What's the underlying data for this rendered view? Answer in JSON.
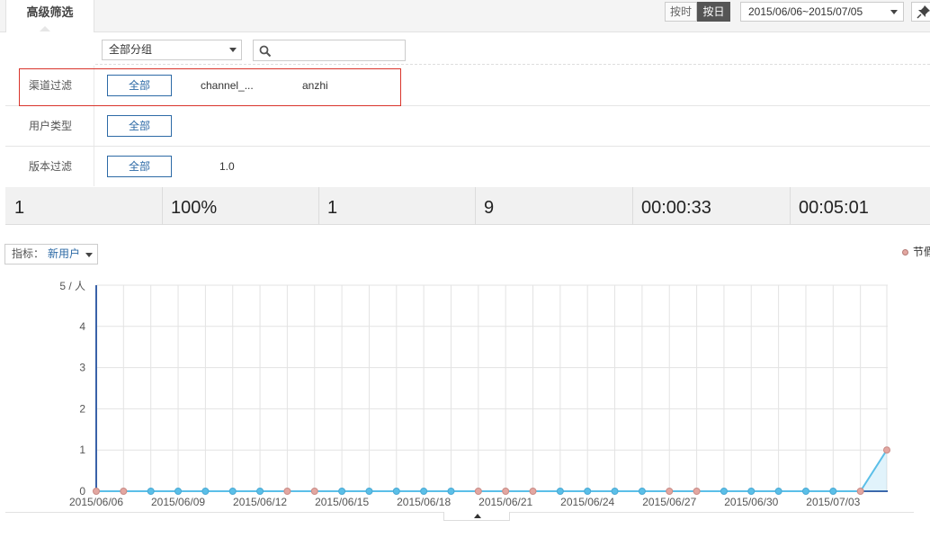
{
  "topbar": {
    "advanced_filter_tab": "高级筛选",
    "by_hour": "按时",
    "by_day": "按日",
    "date_range": "2015/06/06~2015/07/05"
  },
  "filters": {
    "group_select": "全部分组",
    "search_placeholder": "",
    "rows": [
      {
        "label": "渠道过滤",
        "all": "全部",
        "options": [
          "channel_...",
          "anzhi"
        ]
      },
      {
        "label": "用户类型",
        "all": "全部",
        "options": []
      },
      {
        "label": "版本过滤",
        "all": "全部",
        "options": [
          "1.0"
        ]
      }
    ]
  },
  "metrics": [
    {
      "value": "1"
    },
    {
      "value": "100%"
    },
    {
      "value": "1"
    },
    {
      "value": "9"
    },
    {
      "value": "00:00:33"
    },
    {
      "value": "00:05:01"
    }
  ],
  "indicator": {
    "label": "指标：",
    "value": "新用户"
  },
  "legend": {
    "label": "节假日"
  },
  "colors": {
    "accent": "#2d6aa6",
    "line": "#5bbfe8",
    "holiday": "#e3a7a1",
    "highlight": "#d9342b"
  },
  "chart_data": {
    "type": "line",
    "x": [
      "2015/06/06",
      "2015/06/07",
      "2015/06/08",
      "2015/06/09",
      "2015/06/10",
      "2015/06/11",
      "2015/06/12",
      "2015/06/13",
      "2015/06/14",
      "2015/06/15",
      "2015/06/16",
      "2015/06/17",
      "2015/06/18",
      "2015/06/19",
      "2015/06/20",
      "2015/06/21",
      "2015/06/22",
      "2015/06/23",
      "2015/06/24",
      "2015/06/25",
      "2015/06/26",
      "2015/06/27",
      "2015/06/28",
      "2015/06/29",
      "2015/06/30",
      "2015/07/01",
      "2015/07/02",
      "2015/07/03",
      "2015/07/04",
      "2015/07/05"
    ],
    "x_tick_labels": [
      "2015/06/06",
      "2015/06/09",
      "2015/06/12",
      "2015/06/15",
      "2015/06/18",
      "2015/06/21",
      "2015/06/24",
      "2015/06/27",
      "2015/06/30",
      "2015/07/03"
    ],
    "series": [
      {
        "values": [
          0,
          0,
          0,
          0,
          0,
          0,
          0,
          0,
          0,
          0,
          0,
          0,
          0,
          0,
          0,
          0,
          0,
          0,
          0,
          0,
          0,
          0,
          0,
          0,
          0,
          0,
          0,
          0,
          0,
          1
        ]
      }
    ],
    "holidays": [
      0,
      1,
      7,
      8,
      14,
      15,
      16,
      21,
      22,
      28,
      29
    ],
    "ylabel": "5 / 人",
    "y_ticks": [
      0,
      1,
      2,
      3,
      4
    ],
    "ylim": [
      0,
      5
    ],
    "grid": true
  }
}
